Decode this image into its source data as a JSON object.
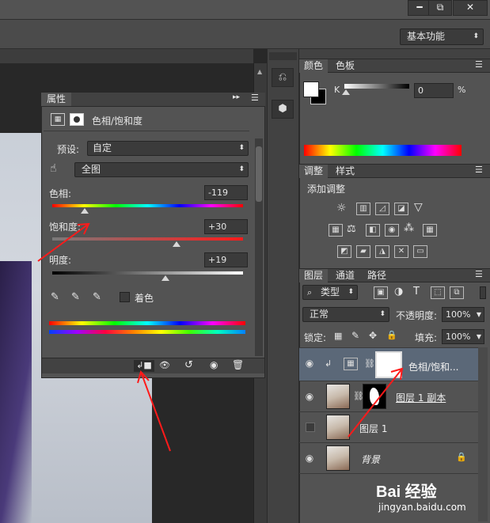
{
  "window": {
    "min_label": "━",
    "restore_label": "⧉",
    "close_label": "✕"
  },
  "workspace": {
    "label": "基本功能"
  },
  "properties": {
    "tab": "属性",
    "title": "色相/饱和度",
    "preset_label": "预设:",
    "preset_value": "自定",
    "channel_value": "全图",
    "hue_label": "色相:",
    "hue_value": "-119",
    "hue": -119,
    "saturation_label": "饱和度:",
    "saturation_value": "+30",
    "saturation": 30,
    "lightness_label": "明度:",
    "lightness_value": "+19",
    "lightness": 19,
    "colorize_label": "着色"
  },
  "color_panel": {
    "tabs": [
      "颜色",
      "色板"
    ],
    "k_label": "K",
    "k_value": "0",
    "unit": "%"
  },
  "adjust_panel": {
    "tabs": [
      "调整",
      "样式"
    ],
    "heading": "添加调整"
  },
  "layers_panel": {
    "tabs": [
      "图层",
      "通道",
      "路径"
    ],
    "filter_value": "类型",
    "blend_mode": "正常",
    "opacity_label": "不透明度:",
    "opacity_value": "100%",
    "lock_label": "锁定:",
    "fill_label": "填充:",
    "fill_value": "100%",
    "layers": [
      {
        "name": "色相/饱和...",
        "visible": true
      },
      {
        "name": "图层 1 副本",
        "visible": true
      },
      {
        "name": "图层 1",
        "visible": false
      },
      {
        "name": "背景",
        "visible": true
      }
    ]
  },
  "watermark": {
    "brand": "Bai 经验",
    "url": "jingyan.baidu.com"
  },
  "colors": {
    "accent": "#5b6878",
    "arrow": "#ff1a1a"
  }
}
